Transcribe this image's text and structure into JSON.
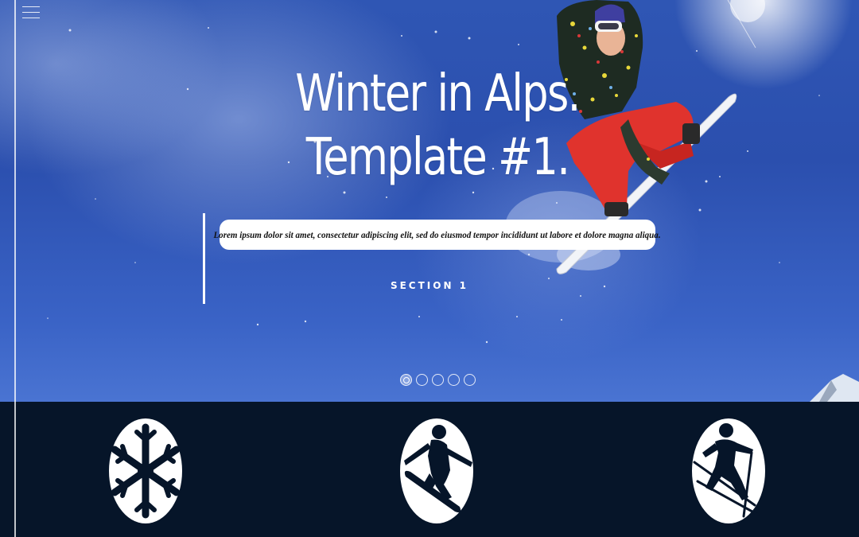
{
  "header": {
    "menu_icon": "hamburger-menu-icon"
  },
  "hero": {
    "title": "Winter in Alps. Template #1.",
    "lead": "Lorem ipsum dolor sit amet, consectetur adipiscing elit, sed do eiusmod tempor incididunt ut labore et dolore magna aliqua.",
    "section_link": "SECTION 1",
    "slides": 5,
    "active_slide": 1
  },
  "features": {
    "icons": [
      "snowflake-icon",
      "snowboarder-icon",
      "skier-icon"
    ]
  },
  "colors": {
    "sky": "#2f56b4",
    "band": "#061529",
    "text": "#ffffff"
  }
}
